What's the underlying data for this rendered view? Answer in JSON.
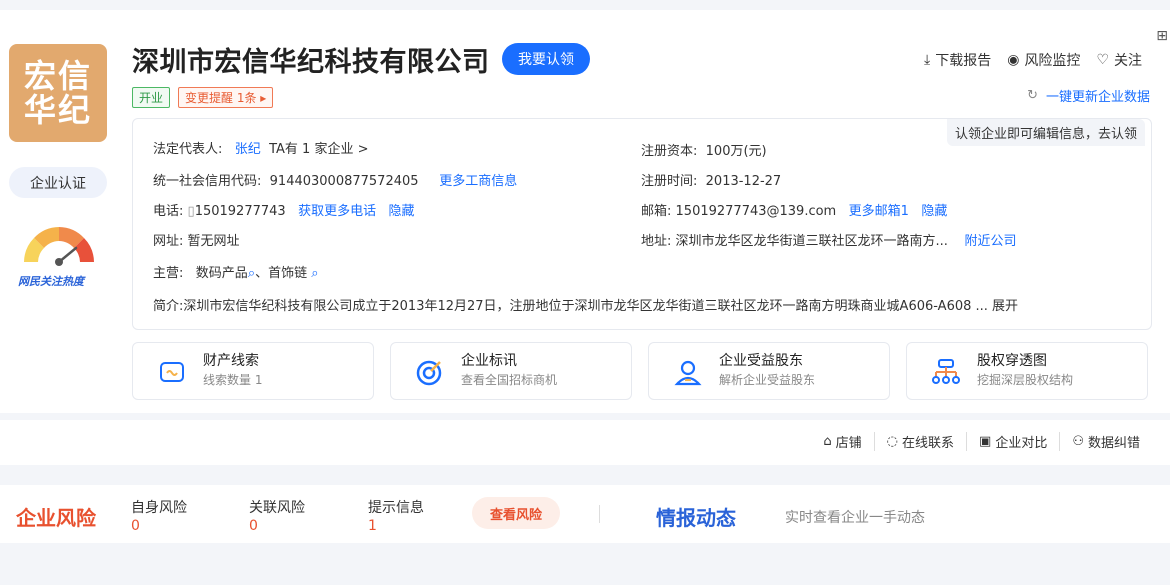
{
  "company": {
    "logo_text": "宏信华纪",
    "name": "深圳市宏信华纪科技有限公司",
    "claim_label": "我要认领",
    "status_tag": "开业",
    "change_tag": "变更提醒 1条",
    "cert_label": "企业认证",
    "heat_label": "网民关注热度"
  },
  "top_actions": {
    "download": "下载报告",
    "monitor": "风险监控",
    "follow": "关注",
    "update": "一键更新企业数据"
  },
  "info": {
    "tip": "认领企业即可编辑信息，去认领",
    "legal_rep_label": "法定代表人:",
    "legal_rep_name": "张纪",
    "legal_rep_more": "TA有 1 家企业 >",
    "capital_label": "注册资本:",
    "capital_value": "100万(元)",
    "credit_label": "统一社会信用代码:",
    "credit_value": "914403000877572405",
    "credit_more": "更多工商信息",
    "reg_time_label": "注册时间:",
    "reg_time_value": "2013-12-27",
    "phone_label": "电话:",
    "phone_value": "15019277743",
    "phone_more": "获取更多电话",
    "phone_hide": "隐藏",
    "email_label": "邮箱:",
    "email_value": "15019277743@139.com",
    "email_more": "更多邮箱1",
    "email_hide": "隐藏",
    "website_label": "网址:",
    "website_value": "暂无网址",
    "address_label": "地址:",
    "address_value": "深圳市龙华区龙华街道三联社区龙环一路南方...",
    "address_more": "附近公司",
    "business_label": "主营:",
    "business_1": "数码产品",
    "business_sep": "、",
    "business_2": "首饰链",
    "intro_label": "简介:",
    "intro_value": "深圳市宏信华纪科技有限公司成立于2013年12月27日，注册地位于深圳市龙华区龙华街道三联社区龙环一路南方明珠商业城A606-A608",
    "intro_more": "... 展开"
  },
  "features": [
    {
      "title": "财产线索",
      "sub": "线索数量 1"
    },
    {
      "title": "企业标讯",
      "sub": "查看全国招标商机"
    },
    {
      "title": "企业受益股东",
      "sub": "解析企业受益股东"
    },
    {
      "title": "股权穿透图",
      "sub": "挖掘深层股权结构"
    }
  ],
  "subbar": {
    "store": "店铺",
    "contact": "在线联系",
    "compare": "企业对比",
    "correct": "数据纠错"
  },
  "risk": {
    "title": "企业风险",
    "self_label": "自身风险",
    "self_value": "0",
    "related_label": "关联风险",
    "related_value": "0",
    "hint_label": "提示信息",
    "hint_value": "1",
    "view_label": "查看风险"
  },
  "intel": {
    "title": "情报动态",
    "sub": "实时查看企业一手动态"
  },
  "colors": {
    "brand_blue": "#1a6eff",
    "risk_red": "#e8512f",
    "logo_bg": "#e2a96e"
  }
}
